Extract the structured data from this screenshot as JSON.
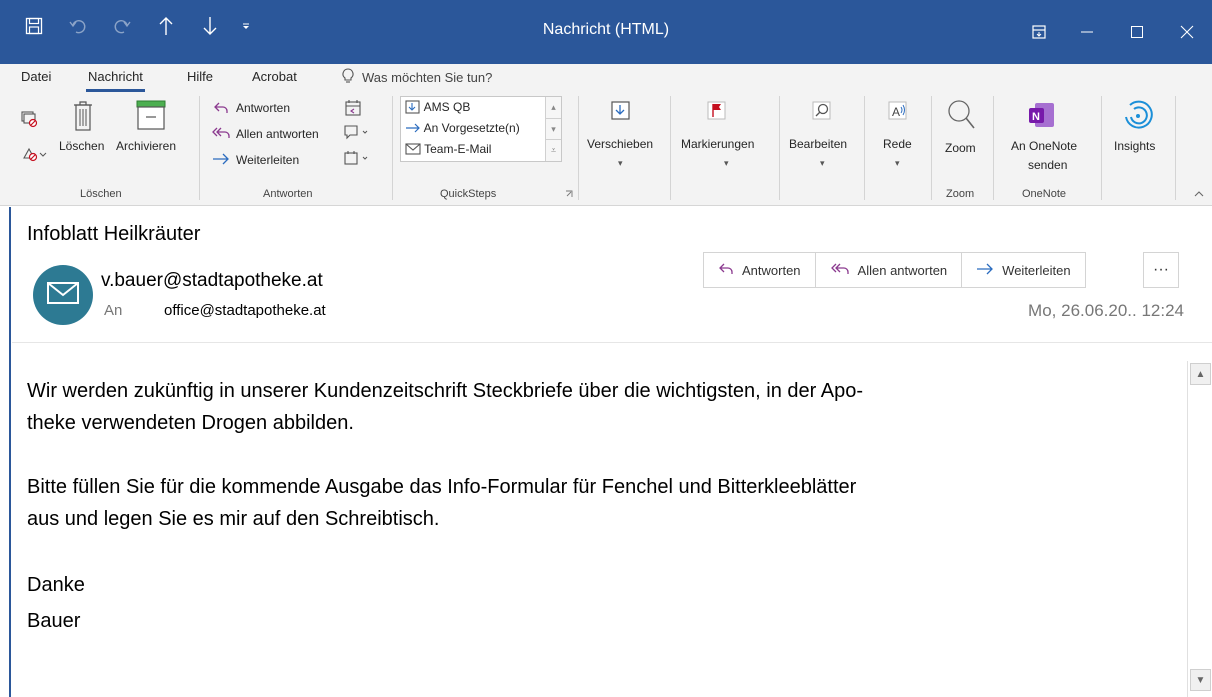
{
  "window": {
    "title": "Nachricht (HTML)",
    "qat_icons": [
      "save-icon",
      "undo-icon",
      "redo-icon",
      "up-arrow-icon",
      "down-arrow-icon",
      "customize-icon"
    ]
  },
  "menu": {
    "tabs": [
      "Datei",
      "Nachricht",
      "Hilfe",
      "Acrobat"
    ],
    "active_tab": "Nachricht",
    "tell_me": "Was möchten Sie tun?"
  },
  "ribbon": {
    "groups": {
      "loeschen": "Löschen",
      "antworten": "Antworten",
      "quicksteps": "QuickSteps",
      "zoom": "Zoom",
      "onenote": "OneNote"
    },
    "delete_label": "Löschen",
    "archive_label": "Archivieren",
    "reply_label": "Antworten",
    "reply_all_label": "Allen antworten",
    "forward_label": "Weiterleiten",
    "quicksteps": [
      "AMS QB",
      "An Vorgesetzte(n)",
      "Team-E-Mail"
    ],
    "move_label": "Verschieben",
    "tags_label": "Markierungen",
    "edit_label": "Bearbeiten",
    "speech_label": "Rede",
    "zoom_label": "Zoom",
    "onenote_line1": "An OneNote",
    "onenote_line2": "senden",
    "insights_label": "Insights"
  },
  "message": {
    "subject": "Infoblatt Heilkräuter",
    "sender": "v.bauer@stadtapotheke.at",
    "to_label": "An",
    "to": "office@stadtapotheke.at",
    "datetime": "Mo, 26.06.20..  12:24",
    "actions": {
      "reply": "Antworten",
      "reply_all": "Allen antworten",
      "forward": "Weiterleiten",
      "more": "···"
    },
    "body": {
      "p1": "Wir werden zukünftig in unserer Kundenzeitschrift Steckbriefe über die wichtigsten, in der Apo-theke verwendeten Drogen abbilden.",
      "p1_line1": "Wir werden zukünftig in unserer Kundenzeitschrift Steckbriefe über die wichtigsten, in der Apo-",
      "p1_line2": "theke verwendeten Drogen abbilden.",
      "p2_line1": "Bitte füllen Sie für die kommende Ausgabe das Info-Formular für Fenchel und Bitterkleeblätter",
      "p2_line2": "aus und legen Sie es mir auf den Schreibtisch.",
      "closing": "Danke",
      "signature": "Bauer"
    }
  },
  "colors": {
    "titlebar": "#2b579a",
    "ribbon_bg": "#f3f3f3",
    "avatar": "#2d7a93",
    "onenote": "#7719aa",
    "flag": "#c50f1f",
    "insights": "#1b8fd8"
  }
}
